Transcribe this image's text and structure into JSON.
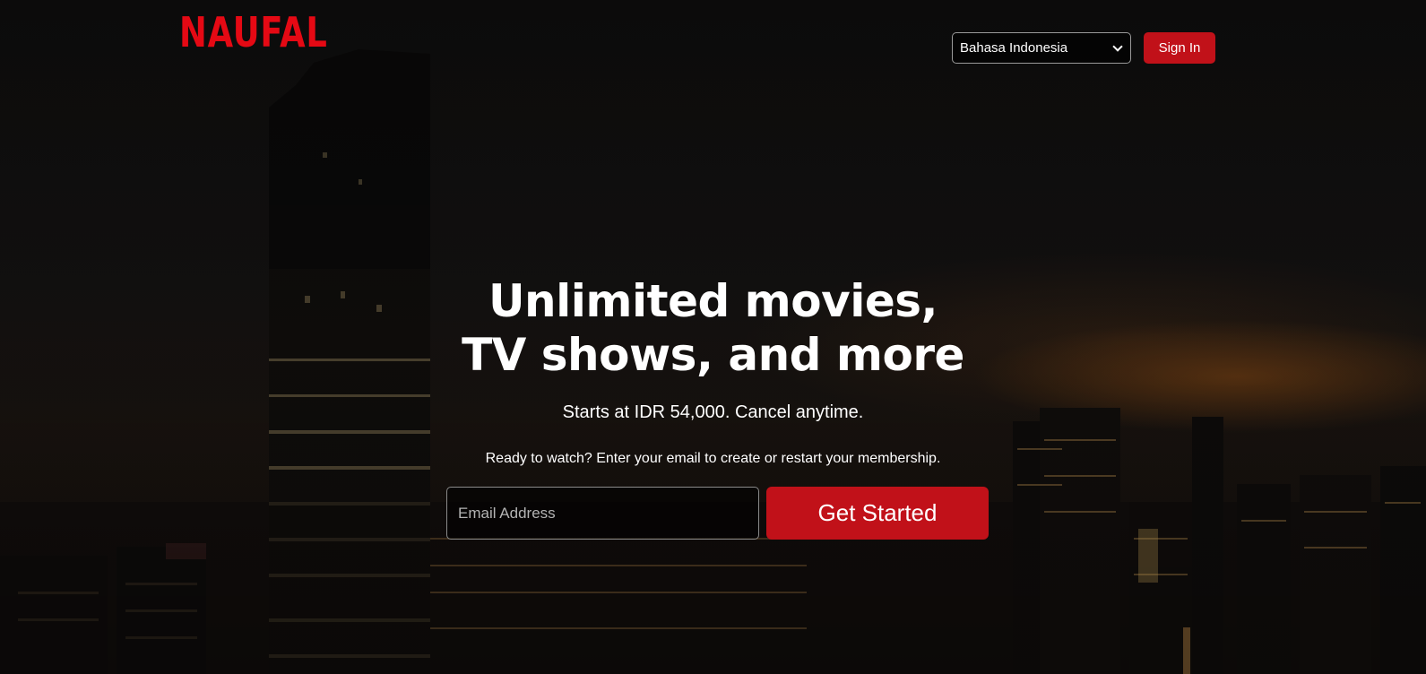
{
  "header": {
    "logo_text": "NAUFAL",
    "language_select": {
      "selected": "Bahasa Indonesia",
      "icon": "chevron-down-icon"
    },
    "sign_in_label": "Sign In"
  },
  "hero": {
    "headline_line1": "Unlimited movies,",
    "headline_line2": "TV shows, and more",
    "subtitle": "Starts at IDR 54,000. Cancel anytime.",
    "prompt": "Ready to watch? Enter your email to create or restart your membership.",
    "email_placeholder": "Email Address",
    "cta_label": "Get Started"
  },
  "colors": {
    "brand_red": "#e50914",
    "button_red": "#c11119",
    "text": "#ffffff"
  }
}
